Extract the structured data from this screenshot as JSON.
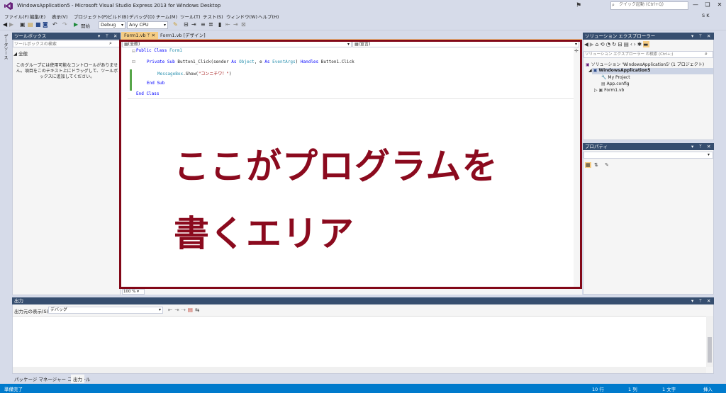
{
  "window": {
    "title": "WindowsApplication5 - Microsoft Visual Studio Express 2013 for Windows Desktop",
    "quick_launch_placeholder": "クイック起動 (Ctrl+Q)",
    "minimize": "—",
    "restore": "❏",
    "close": "✕"
  },
  "menu": {
    "items": [
      "ファイル(F)",
      "編集(E)",
      "表示(V)",
      "プロジェクト(P)",
      "ビルド(B)",
      "デバッグ(D)",
      "チーム(M)",
      "ツール(T)",
      "テスト(S)",
      "ウィンドウ(W)",
      "ヘルプ(H)"
    ],
    "user": "S K"
  },
  "toolbar": {
    "start_label": "開始",
    "config": "Debug",
    "platform": "Any CPU"
  },
  "left_strip": {
    "label": "データソース"
  },
  "toolbox": {
    "title": "ツールボックス",
    "search_placeholder": "ツールボックスの検索",
    "group": "全般",
    "empty_message": "このグループには使用可能なコントロールがありません。項目をこのテキスト上にドラッグして、ツールボックスに追加してください。"
  },
  "tabs": {
    "code": "Form1.vb",
    "design": "Form1.vb [デザイン]"
  },
  "editor": {
    "nav_left": "(全般)",
    "nav_right": "(宣言)",
    "zoom": "100 %",
    "lines": {
      "l1_kw": "Public Class",
      "l1_name": "Form1",
      "l2_kw1": "Private Sub",
      "l2_mid": "Button1_Click(sender",
      "l2_as1": "As",
      "l2_t1": "Object",
      "l2_e": ", e",
      "l2_as2": "As",
      "l2_t2": "EventArgs",
      "l2_handles": "Handles",
      "l2_tail": "Button1.Click",
      "l3_type": "MessageBox",
      "l3_call": ".Show(",
      "l3_str": "\"コンニチワ！\"",
      "l3_close": ")",
      "l4": "End Sub",
      "l5": "End Class"
    }
  },
  "callout": {
    "line1": "ここがプログラムを",
    "line2": "書くエリア"
  },
  "solution_explorer": {
    "title": "ソリューション エクスプローラー",
    "search_placeholder": "ソリューション エクスプローラー の検索 (Ctrl+;)",
    "solution": "ソリューション 'WindowsApplication5' (1 プロジェクト)",
    "project": "WindowsApplication5",
    "items": [
      "My Project",
      "App.config",
      "Form1.vb"
    ]
  },
  "properties": {
    "title": "プロパティ"
  },
  "output": {
    "title": "出力",
    "source_label": "出力元の表示(S):",
    "source_value": "デバッグ"
  },
  "bottom_tabs": {
    "pkg": "パッケージ マネージャー コンソール",
    "output": "出力"
  },
  "status": {
    "ready": "準備完了",
    "line": "10 行",
    "col": "1 列",
    "char": "1 文字",
    "mode": "挿入"
  },
  "colors": {
    "accent_status": "#007acc",
    "callout": "#8b0a1e",
    "active_tab": "#f5cc84"
  }
}
